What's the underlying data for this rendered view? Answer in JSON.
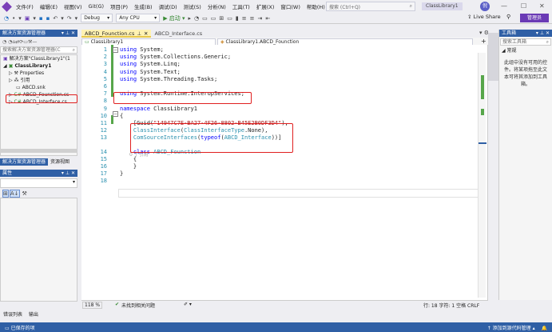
{
  "menu": {
    "items": [
      "文件(F)",
      "编辑(E)",
      "视图(V)",
      "Git(G)",
      "项目(P)",
      "生成(B)",
      "调试(D)",
      "测试(S)",
      "分析(N)",
      "工具(T)",
      "扩展(X)",
      "窗口(W)",
      "帮助(H)"
    ],
    "search_placeholder": "搜索 (Ctrl+Q)",
    "solution_name": "ClassLibrary1",
    "avatar": "倪",
    "window_min": "—",
    "window_max": "☐",
    "window_close": "✕"
  },
  "toolbar": {
    "config": "Debug",
    "platform": "Any CPU",
    "start": "▶ 启动 ▾",
    "live_share": "Live Share",
    "admin": "管理员"
  },
  "solution_explorer": {
    "title": "解决方案资源管理器",
    "search_placeholder": "搜索解决方案资源管理器(C",
    "solution": "解决方案\"ClassLibrary1\"(1",
    "project": "ClassLibrary1",
    "items": [
      "Properties",
      "引用",
      "ABCD.snk",
      "ABCD_Founction.cs",
      "ABCD_Interface.cs"
    ],
    "tabs": [
      "解决方案资源管理器",
      "资源视图"
    ]
  },
  "properties": {
    "title": "属性"
  },
  "editor": {
    "tabs": [
      {
        "label": "ABCD_Founction.cs",
        "active": true
      },
      {
        "label": "ABCD_Interface.cs",
        "active": false
      }
    ],
    "nav_project": "ClassLibrary1",
    "nav_class": "ClassLibrary1.ABCD_Founction",
    "lines": [
      {
        "n": "1",
        "tokens": [
          [
            "kw",
            "using"
          ],
          [
            "",
            "System;"
          ]
        ]
      },
      {
        "n": "2",
        "tokens": [
          [
            "kw",
            "using"
          ],
          [
            "",
            "System.Collections.Generic;"
          ]
        ]
      },
      {
        "n": "3",
        "tokens": [
          [
            "kw",
            "using"
          ],
          [
            "",
            "System.Linq;"
          ]
        ]
      },
      {
        "n": "4",
        "tokens": [
          [
            "kw",
            "using"
          ],
          [
            "",
            "System.Text;"
          ]
        ]
      },
      {
        "n": "5",
        "tokens": [
          [
            "kw",
            "using"
          ],
          [
            "",
            "System.Threading.Tasks;"
          ]
        ]
      },
      {
        "n": "6",
        "tokens": []
      },
      {
        "n": "7",
        "tokens": [
          [
            "kw",
            "using"
          ],
          [
            "",
            "System.Runtime.InteropServices;"
          ]
        ]
      },
      {
        "n": "8",
        "tokens": []
      },
      {
        "n": "9",
        "tokens": [
          [
            "kw",
            "namespace"
          ],
          [
            "",
            "ClassLibrary1"
          ]
        ]
      },
      {
        "n": "10",
        "tokens": [
          [
            "",
            "{"
          ]
        ]
      },
      {
        "n": "11",
        "tokens": [
          [
            "",
            "    [Guid("
          ],
          [
            "str",
            "\"14947C7E-BA27-4F26-8802-B45E2B0DF3D4\""
          ],
          [
            "",
            "),"
          ]
        ]
      },
      {
        "n": "12",
        "tokens": [
          [
            "ty",
            "    ClassInterface"
          ],
          [
            "",
            "("
          ],
          [
            "ty",
            "ClassInterfaceType"
          ],
          [
            "",
            ".None),"
          ]
        ]
      },
      {
        "n": "13",
        "tokens": [
          [
            "ty",
            "    ComSourceInterfaces"
          ],
          [
            "",
            "("
          ],
          [
            "kw",
            "typeof"
          ],
          [
            "",
            "("
          ],
          [
            "ty",
            "ABCD_Interface"
          ],
          [
            "",
            "))]"
          ]
        ]
      },
      {
        "n": "14",
        "tokens": [
          [
            "kw",
            "    class"
          ],
          [
            "ty",
            " ABCD_Founction"
          ]
        ]
      },
      {
        "n": "15",
        "tokens": [
          [
            "",
            "    {"
          ]
        ]
      },
      {
        "n": "16",
        "tokens": [
          [
            "",
            "    }"
          ]
        ]
      },
      {
        "n": "17",
        "tokens": [
          [
            "",
            "}"
          ]
        ]
      },
      {
        "n": "18",
        "tokens": []
      }
    ],
    "codelens": "0 个引用"
  },
  "editor_status": {
    "zoom": "118 %",
    "issues": "未找到相关问题",
    "position": "行: 18   字符: 1   空格   CRLF"
  },
  "output_tabs": [
    "错误列表",
    "输出"
  ],
  "statusbar": {
    "left": "已保存的项",
    "right": "添加到源代码管理 ▴"
  },
  "toolbox": {
    "title": "工具箱",
    "search_placeholder": "搜索工具箱",
    "group": "◢ 常规",
    "message": "此组中没有可用的控件。将某项拖至此文本可将其添加到工具箱。"
  }
}
